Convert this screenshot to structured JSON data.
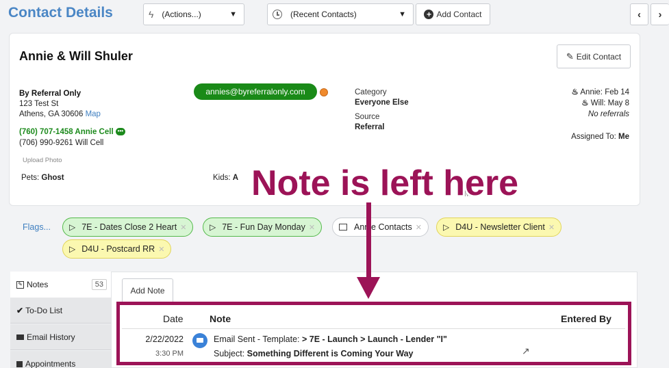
{
  "header": {
    "title": "Contact Details",
    "actions_select": "(Actions...)",
    "recent_select": "(Recent Contacts)",
    "add_contact": "Add Contact"
  },
  "contact": {
    "name": "Annie & Will Shuler",
    "edit_button": "Edit Contact",
    "company": "By Referral Only",
    "address_line1": "123 Test St",
    "address_line2": "Athens, GA 30606",
    "map_link": "Map",
    "phone1": "(760) 707-1458 Annie Cell",
    "phone2": "(706) 990-9261 Will Cell",
    "upload_photo": "Upload Photo",
    "pets_label": "Pets:",
    "pets_value": "Ghost",
    "kids_label": "Kids:",
    "kids_value": "A",
    "email": "annies@byreferralonly.com",
    "category_label": "Category",
    "category_value": "Everyone Else",
    "source_label": "Source",
    "source_value": "Referral",
    "birthday1": "Annie: Feb 14",
    "birthday2": "Will: May 8",
    "referrals": "No referrals",
    "assigned_label": "Assigned To:",
    "assigned_value": "Me",
    "m_fragment": "M"
  },
  "flags": {
    "label": "Flags...",
    "items": [
      {
        "label": "7E - Dates Close 2 Heart",
        "style": "green"
      },
      {
        "label": "7E - Fun Day Monday",
        "style": "green"
      },
      {
        "label": "Annie Contacts",
        "style": "white"
      },
      {
        "label": "D4U - Newsletter Client",
        "style": "yellow"
      },
      {
        "label": "D4U - Postcard RR",
        "style": "yellow"
      }
    ]
  },
  "tabs": {
    "notes": "Notes",
    "notes_count": "53",
    "todo": "To-Do List",
    "email_history": "Email History",
    "appointments": "Appointments"
  },
  "notes": {
    "add_note": "Add Note",
    "col_date": "Date",
    "col_note": "Note",
    "col_entered_by": "Entered By",
    "row1": {
      "date": "2/22/2022",
      "time": "3:30 PM",
      "note_prefix": "Email Sent - Template: ",
      "note_template": "> 7E - Launch > Launch - Lender \"I\"",
      "subject_prefix": "Subject: ",
      "subject": "Something Different is Coming Your Way"
    }
  },
  "annotation": {
    "text": "Note is left here",
    "color": "#9c1357"
  }
}
